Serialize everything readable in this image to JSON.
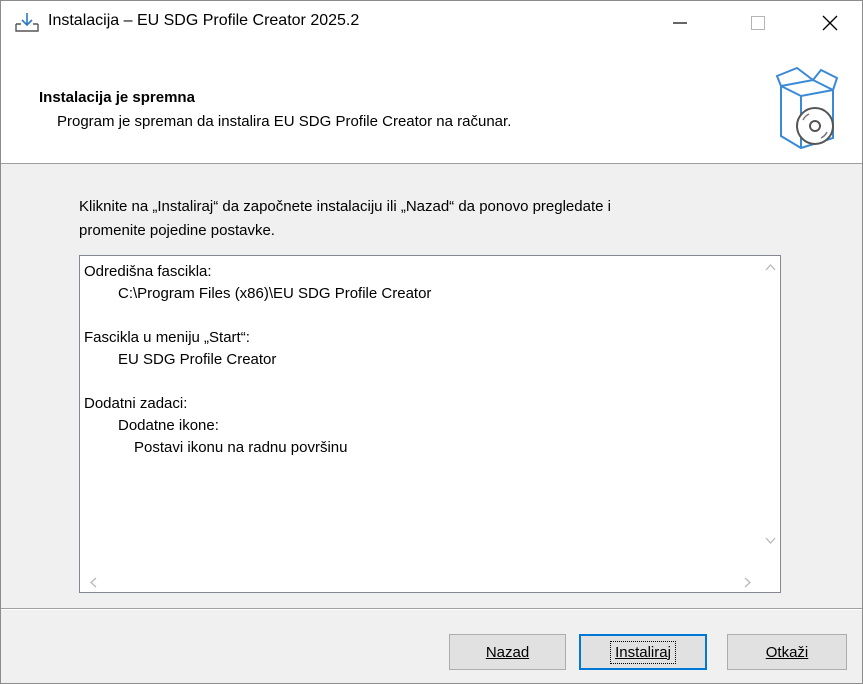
{
  "window": {
    "title": "Instalacija – EU SDG Profile Creator 2025.2",
    "minimize_glyph": "—",
    "maximize_glyph": "☐",
    "close_glyph": "✕"
  },
  "header": {
    "title": "Instalacija je spremna",
    "subtitle": "Program je spreman da instalira EU SDG Profile Creator na računar."
  },
  "intro": {
    "line1": "Kliknite na „Instaliraj“ da započnete instalaciju ili „Nazad“ da ponovo pregledate i",
    "line2": "promenite pojedine postavke."
  },
  "memo": {
    "lines": [
      "Odredišna fascikla:",
      "      C:\\Program Files (x86)\\EU SDG Profile Creator",
      "",
      "Fascikla u meniju „Start“:",
      "      EU SDG Profile Creator",
      "",
      "Dodatni zadaci:",
      "      Dodatne ikone:",
      "         Postavi ikonu na radnu površinu"
    ]
  },
  "buttons": {
    "back": "Nazad",
    "install": "Instaliraj",
    "cancel": "Otkaži"
  },
  "colors": {
    "accent": "#0078d7",
    "dialog_bg": "#f0f0f0"
  },
  "icons": {
    "title": "installer-download-icon",
    "header": "software-box-cd-icon"
  }
}
